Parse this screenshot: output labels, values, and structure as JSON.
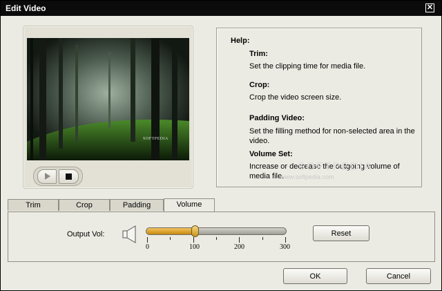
{
  "window": {
    "title": "Edit Video",
    "close_glyph": "✕"
  },
  "player": {
    "watermark": "SOFTPEDIA",
    "play_icon": "play-icon",
    "stop_icon": "stop-icon"
  },
  "help": {
    "title": "Help:",
    "sections": [
      {
        "heading": "Trim:",
        "text": "Set the clipping time for media file."
      },
      {
        "heading": "Crop:",
        "text": "Crop the video screen size."
      },
      {
        "heading": "Padding Video:",
        "text": "Set the filling method for non-selected area in the video."
      },
      {
        "heading": "Volume Set:",
        "text": "Increase or decrease the outgoing volume of media file."
      }
    ],
    "watermark": "SOFTPEDIA",
    "watermark_url": "www.softpedia.com"
  },
  "tabs": [
    {
      "label": "Trim",
      "active": false
    },
    {
      "label": "Crop",
      "active": false
    },
    {
      "label": "Padding",
      "active": false
    },
    {
      "label": "Volume",
      "active": true
    }
  ],
  "volume": {
    "label": "Output Vol:",
    "value": 100,
    "min": 0,
    "max": 300,
    "tick_labels": [
      "0",
      "100",
      "200",
      "300"
    ],
    "reset_label": "Reset"
  },
  "footer": {
    "ok_label": "OK",
    "cancel_label": "Cancel"
  },
  "colors": {
    "titlebar": "#0b0b0b",
    "dialog_bg": "#ecebe3",
    "slider_fill": "#e0a630"
  }
}
